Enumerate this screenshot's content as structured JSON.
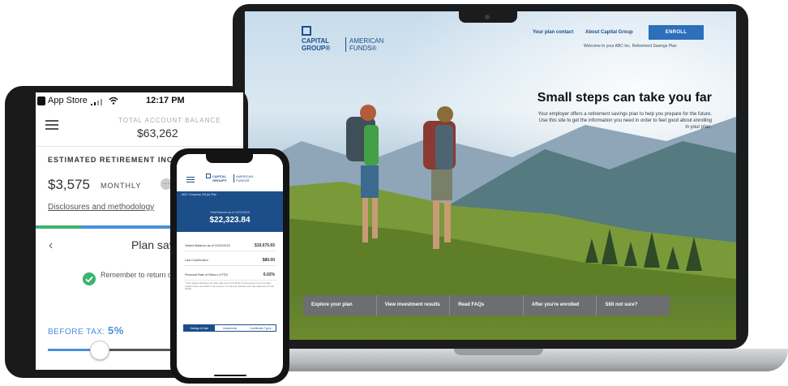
{
  "laptop": {
    "header": {
      "logo_cg": "CAPITAL GROUP®",
      "logo_af": "AMERICAN FUNDS®",
      "link_plan_contact": "Your plan contact",
      "link_about": "About Capital Group",
      "enroll_label": "ENROLL",
      "welcome": "Welcome to your ABC Inc. Retirement Savings Plan"
    },
    "hero": {
      "title": "Small steps can take you far",
      "subtitle": "Your employer offers a retirement savings plan to help you prepare for the future. Use this site to get the information you need in order to feel good about enrolling in your plan."
    },
    "nav": [
      {
        "label": "Explore your plan"
      },
      {
        "label": "View investment results"
      },
      {
        "label": "Read FAQs"
      },
      {
        "label": "After you're enrolled"
      },
      {
        "label": "Still not sure?"
      }
    ]
  },
  "tablet": {
    "status": {
      "back_app": "App Store",
      "time": "12:17 PM"
    },
    "balance_label": "TOTAL ACCOUNT BALANCE",
    "balance": "$63,262",
    "estimate_label": "ESTIMATED RETIREMENT INCOME",
    "amount": "$3,575",
    "frequency": "MONTHLY",
    "disclosures": "Disclosures and methodology",
    "page_title": "Plan sav",
    "reminder": "Remember to return o your progress.",
    "before_tax_label": "BEFORE TAX:",
    "before_tax_value": "5%",
    "progress_fraction": 0.22,
    "slider_fraction": 0.28
  },
  "phone": {
    "logo_cg": "CAPITAL GROUP®",
    "logo_af": "AMERICAN FUNDS®",
    "plan_name": "ABC Company 401(k) Plan",
    "total_label": "Total Balance as of 10/31/2019",
    "total": "$22,323.84",
    "rows": [
      {
        "label": "Vested Balance as of 10/31/2019",
        "value": "$19,675.65"
      },
      {
        "label": "Last Contribution",
        "value": "$80.00"
      },
      {
        "label": "Personal Rate of Return (YTD)*",
        "value": "6.02%"
      }
    ],
    "note": "* Your ratings reflecting your plan data may not fit all the current query if your net date selected does not match in the account. It is also an estimate only. See disclosure for full details.",
    "tabs": [
      {
        "label": "Savings to Date",
        "active": true
      },
      {
        "label": "Investments",
        "active": false
      },
      {
        "label": "Contribution Types",
        "active": false
      }
    ]
  },
  "colors": {
    "brand_blue": "#1c4e8a",
    "enroll_blue": "#2d6fba",
    "accent_blue": "#4a90d9",
    "success_green": "#3cb371",
    "nav_gray": "#6c6e70"
  }
}
